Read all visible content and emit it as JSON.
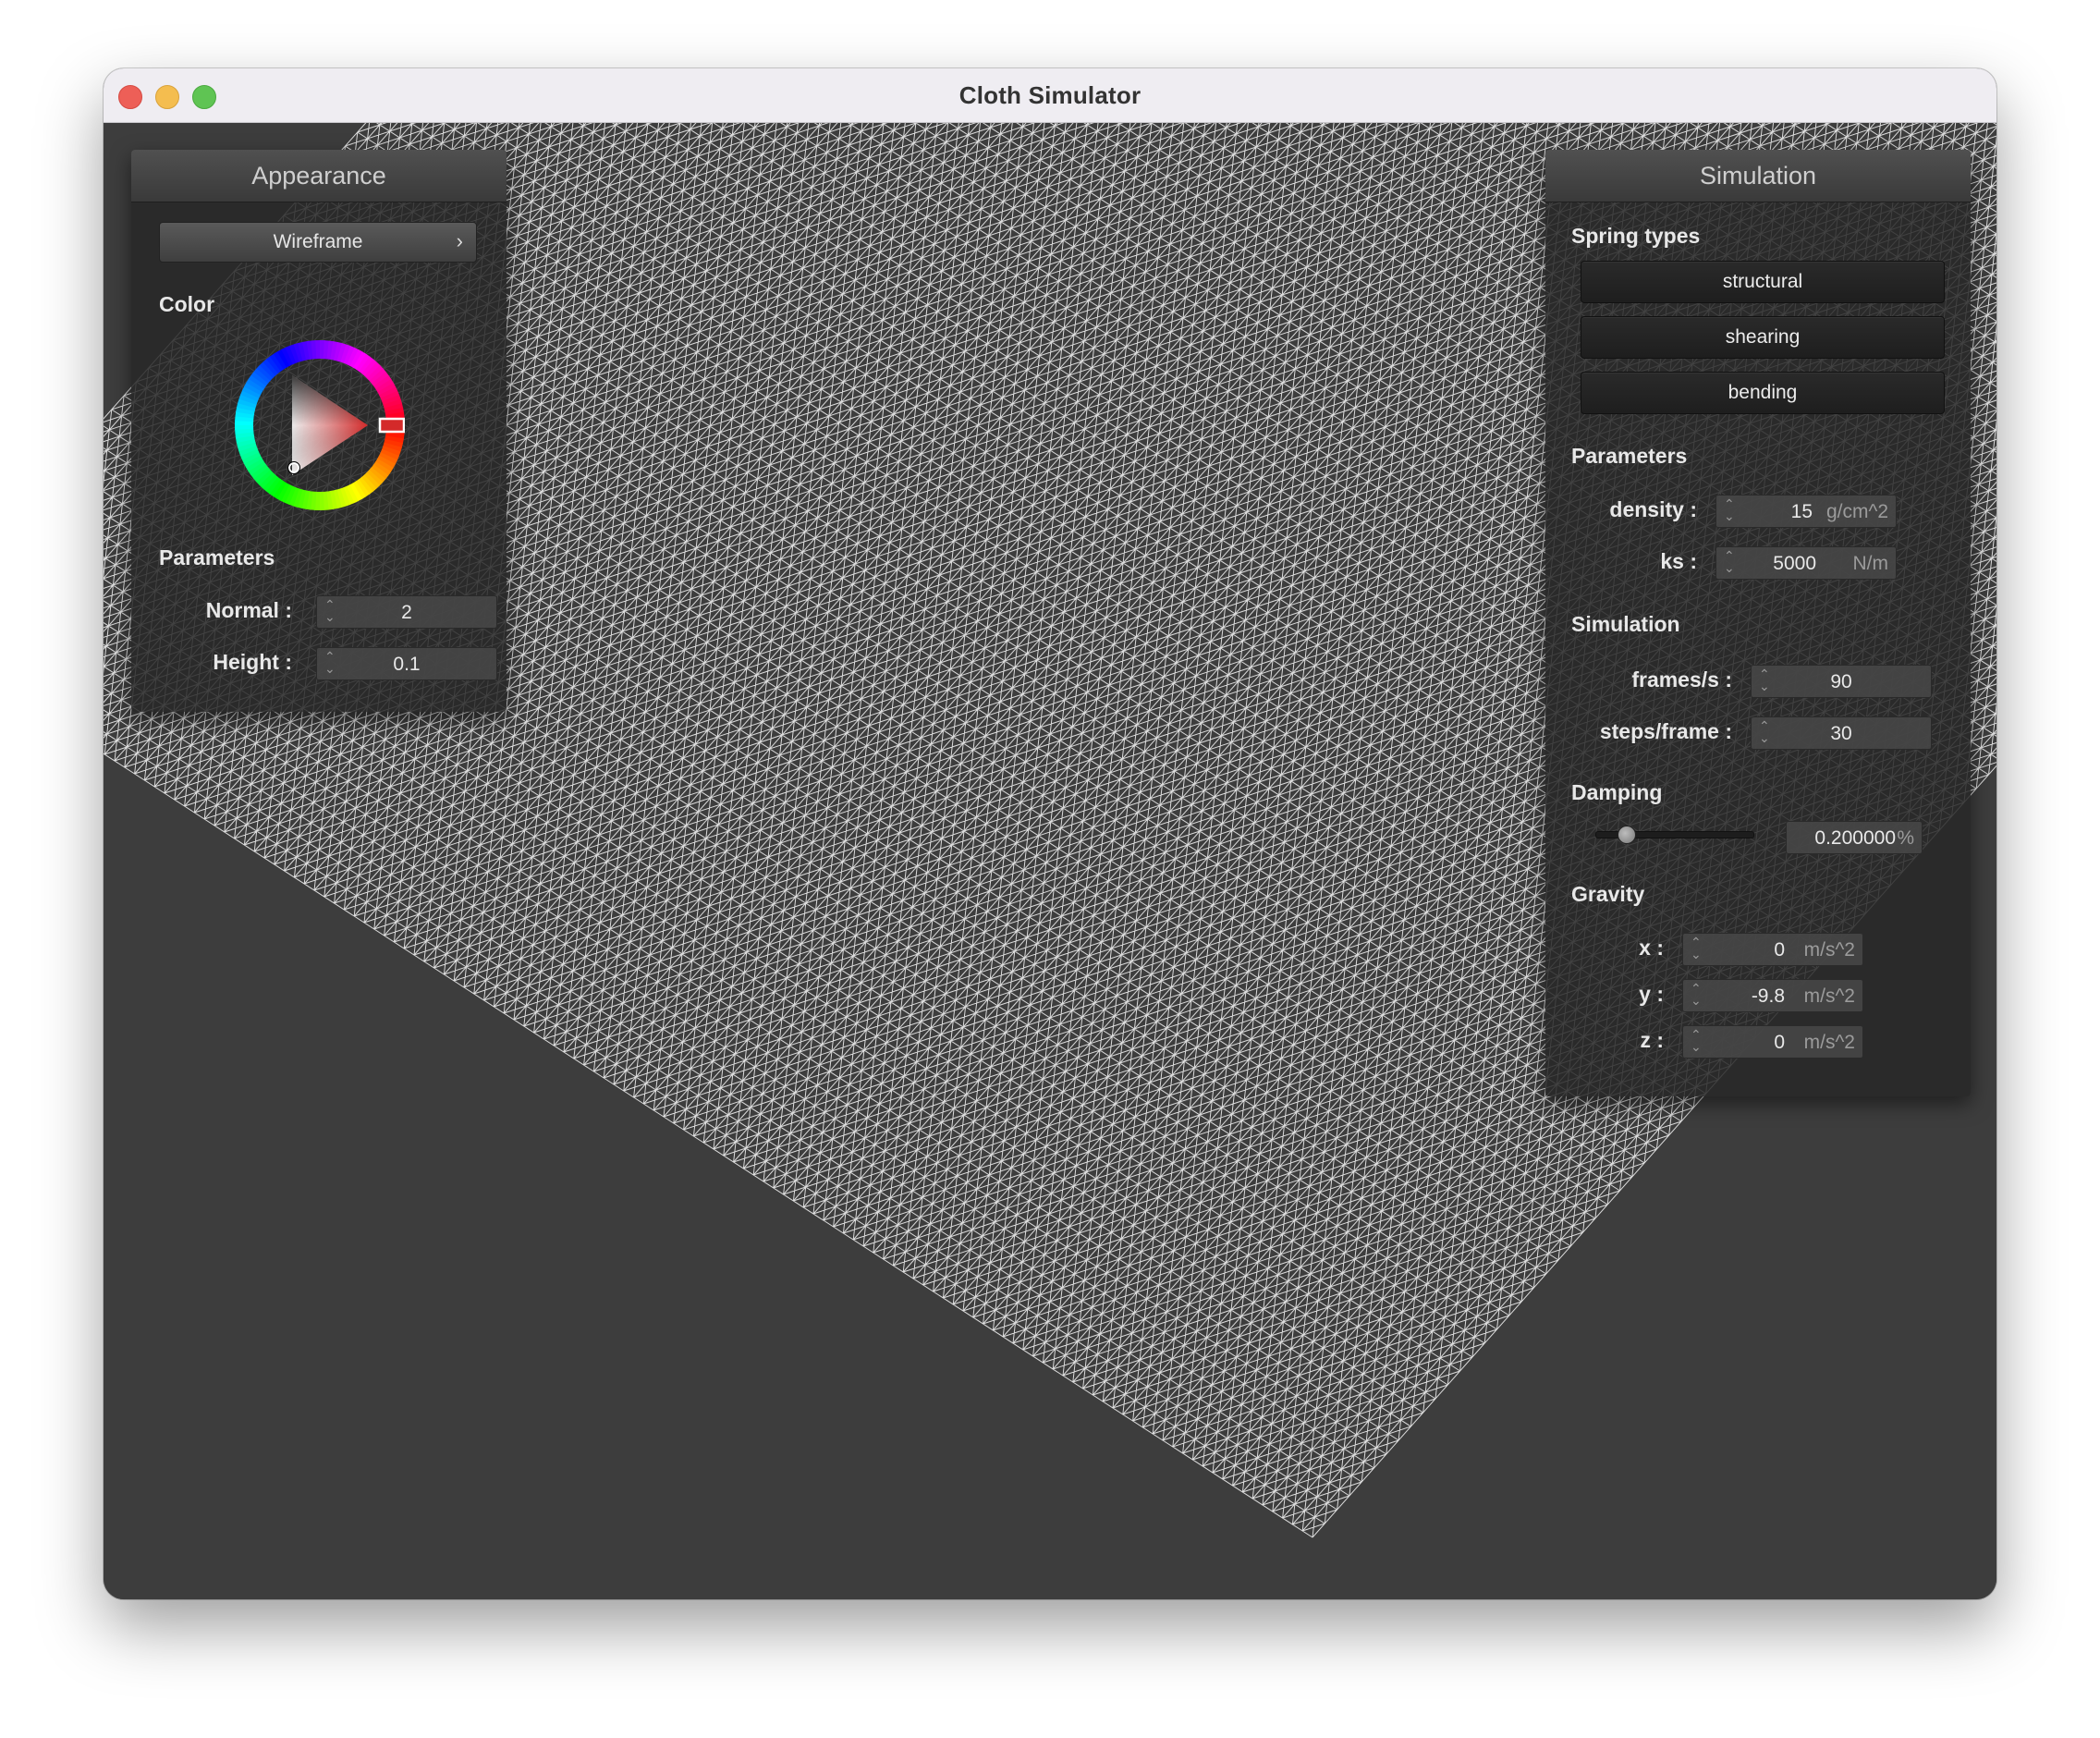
{
  "window": {
    "title": "Cloth Simulator"
  },
  "colors": {
    "mesh": "#ffffff",
    "background": "#3d3d3d",
    "selected_color": "#cc2a2a"
  },
  "appearance": {
    "header": "Appearance",
    "shader_button": "Wireframe",
    "shader_chevron": "›",
    "color_label": "Color",
    "parameters_label": "Parameters",
    "normal_label": "Normal :",
    "normal_value": "2",
    "height_label": "Height :",
    "height_value": "0.1"
  },
  "simulation": {
    "header": "Simulation",
    "spring_types_label": "Spring types",
    "springs": [
      "structural",
      "shearing",
      "bending"
    ],
    "parameters_label": "Parameters",
    "density_label": "density :",
    "density_value": "15",
    "density_unit": "g/cm^2",
    "ks_label": "ks :",
    "ks_value": "5000",
    "ks_unit": "N/m",
    "simulation_label": "Simulation",
    "fps_label": "frames/s :",
    "fps_value": "90",
    "steps_label": "steps/frame :",
    "steps_value": "30",
    "damping_label": "Damping",
    "damping_value": "0.200000",
    "damping_unit": "%",
    "damping_level": 0.2,
    "gravity_label": "Gravity",
    "gravity": [
      {
        "label": "x :",
        "value": "0",
        "unit": "m/s^2"
      },
      {
        "label": "y :",
        "value": "-9.8",
        "unit": "m/s^2"
      },
      {
        "label": "z :",
        "value": "0",
        "unit": "m/s^2"
      }
    ]
  }
}
